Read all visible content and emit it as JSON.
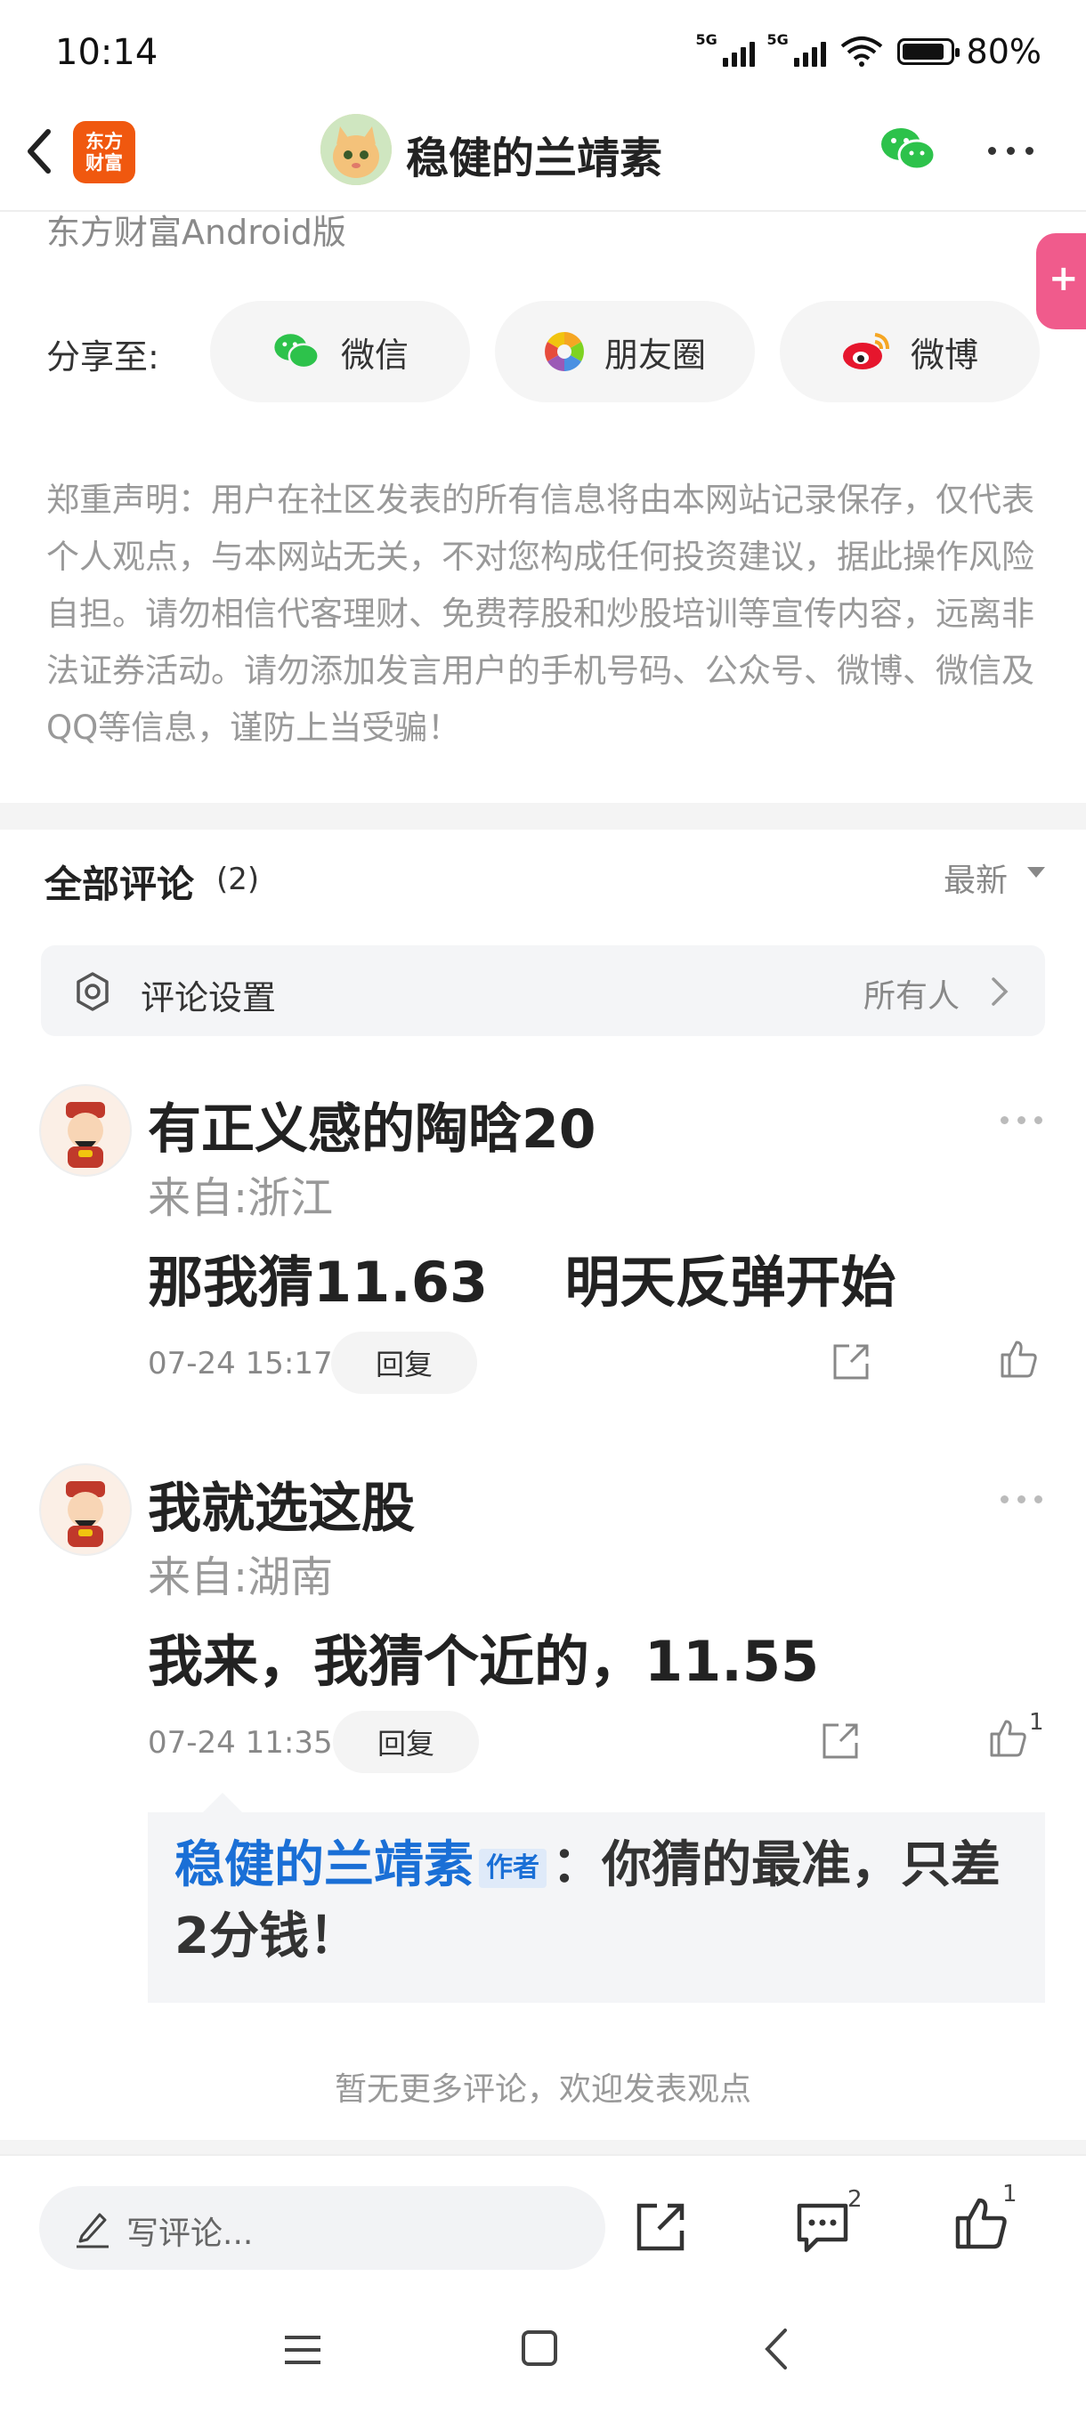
{
  "status_bar": {
    "time": "10:14",
    "net1": "5G",
    "net2": "5G",
    "battery": "80%"
  },
  "nav": {
    "logo_line1": "东方",
    "logo_line2": "财富",
    "title": "稳健的兰靖素"
  },
  "source": "东方财富Android版",
  "share": {
    "label": "分享至:",
    "wechat": "微信",
    "moments": "朋友圈",
    "weibo": "微博"
  },
  "disclaimer": "郑重声明：用户在社区发表的所有信息将由本网站记录保存，仅代表个人观点，与本网站无关，不对您构成任何投资建议，据此操作风险自担。请勿相信代客理财、免费荐股和炒股培训等宣传内容，远离非法证券活动。请勿添加发言用户的手机号码、公众号、微博、微信及QQ等信息，谨防上当受骗！",
  "comments": {
    "title": "全部评论",
    "count": "(2)",
    "sort": "最新",
    "settings_label": "评论设置",
    "settings_value": "所有人",
    "items": [
      {
        "username": "有正义感的陶晗20",
        "location": "来自:浙江",
        "content": "那我猜11.63    明天反弹开始",
        "time": "07-24 15:17",
        "reply_label": "回复",
        "likes": ""
      },
      {
        "username": "我就选这股",
        "location": "来自:湖南",
        "content": "我来，我猜个近的，11.55",
        "time": "07-24 11:35",
        "reply_label": "回复",
        "likes": "1"
      }
    ],
    "reply": {
      "user": "稳健的兰靖素",
      "badge": "作者",
      "text": "：你猜的最准，只差2分钱！"
    },
    "no_more": "暂无更多评论，欢迎发表观点"
  },
  "bottom": {
    "placeholder": "写评论...",
    "comment_count": "2",
    "like_count": "1"
  },
  "colors": {
    "accent": "#1a6fd6",
    "brand": "#f0580f",
    "float": "#f05b8c"
  }
}
